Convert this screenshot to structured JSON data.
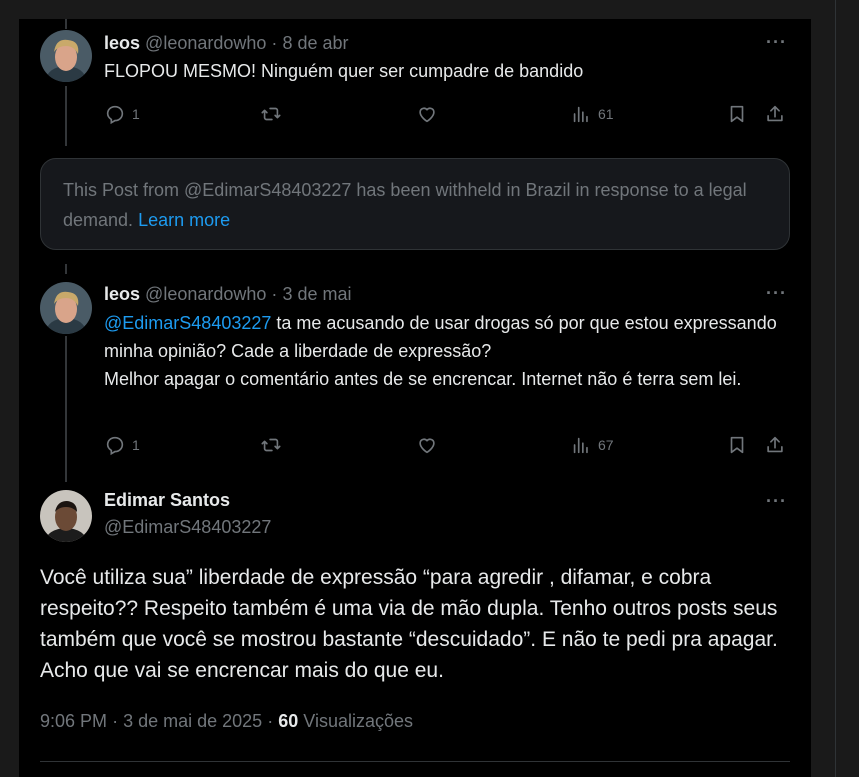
{
  "posts": [
    {
      "name": "leos",
      "handle": "@leonardowho",
      "date": "8 de abr",
      "text": "FLOPOU MESMO! Ninguém quer ser cumpadre de bandido",
      "replies": "1",
      "views": "61"
    },
    {
      "name": "leos",
      "handle": "@leonardowho",
      "date": "3 de mai",
      "mention": "@EdimarS48403227",
      "text_after_mention": " ta me acusando de usar drogas só por que estou expressando minha opinião? Cade a liberdade de expressão?",
      "text_line2": "Melhor apagar o comentário antes de se encrencar. Internet não é terra sem lei.",
      "replies": "1",
      "views": "67"
    }
  ],
  "withheld": {
    "text": "This Post from @EdimarS48403227 has been withheld in Brazil in response to a legal demand.",
    "link": "Learn more"
  },
  "main_post": {
    "name": "Edimar Santos",
    "handle": "@EdimarS48403227",
    "text": "Você utiliza sua” liberdade de expressão “para agredir , difamar, e cobra respeito?? Respeito também é uma via de mão dupla. Tenho outros posts seus também que você se mostrou bastante “descuidado”. E não te pedi pra apagar. Acho que vai se encrencar mais do que eu.",
    "time": "9:06 PM",
    "date": "3 de mai de 2025",
    "views_count": "60",
    "views_label": "Visualizações"
  },
  "separator": "·",
  "more_label": "···",
  "icons": [
    "reply-icon",
    "repost-icon",
    "like-icon",
    "views-icon",
    "bookmark-icon",
    "share-icon",
    "more-icon"
  ],
  "colors": {
    "background": "#000000",
    "text": "#e7e9ea",
    "muted": "#71767b",
    "accent": "#1d9bf0",
    "card": "#16181c"
  }
}
